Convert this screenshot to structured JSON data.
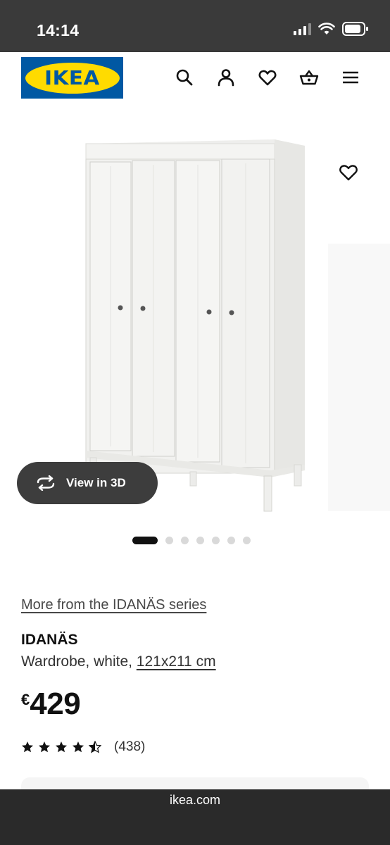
{
  "status_bar": {
    "time": "14:14",
    "icons": [
      "signal-icon",
      "wifi-icon",
      "battery-icon"
    ]
  },
  "header": {
    "logo_text": "IKEA",
    "icons": [
      "search-icon",
      "user-icon",
      "heart-icon",
      "basket-icon",
      "menu-icon"
    ]
  },
  "gallery": {
    "view_3d_label": "View in 3D",
    "image_count": 7,
    "active_index": 0
  },
  "product": {
    "series_link": "More from the IDANÄS series",
    "name": "IDANÄS",
    "description": "Wardrobe, white, ",
    "size": "121x211 cm",
    "currency": "€",
    "price": "429",
    "rating": 4.5,
    "review_count": "(438)"
  },
  "browser": {
    "url": "ikea.com"
  },
  "colors": {
    "brand_blue": "#0058a3",
    "brand_yellow": "#ffdb00",
    "dark": "#111111"
  }
}
